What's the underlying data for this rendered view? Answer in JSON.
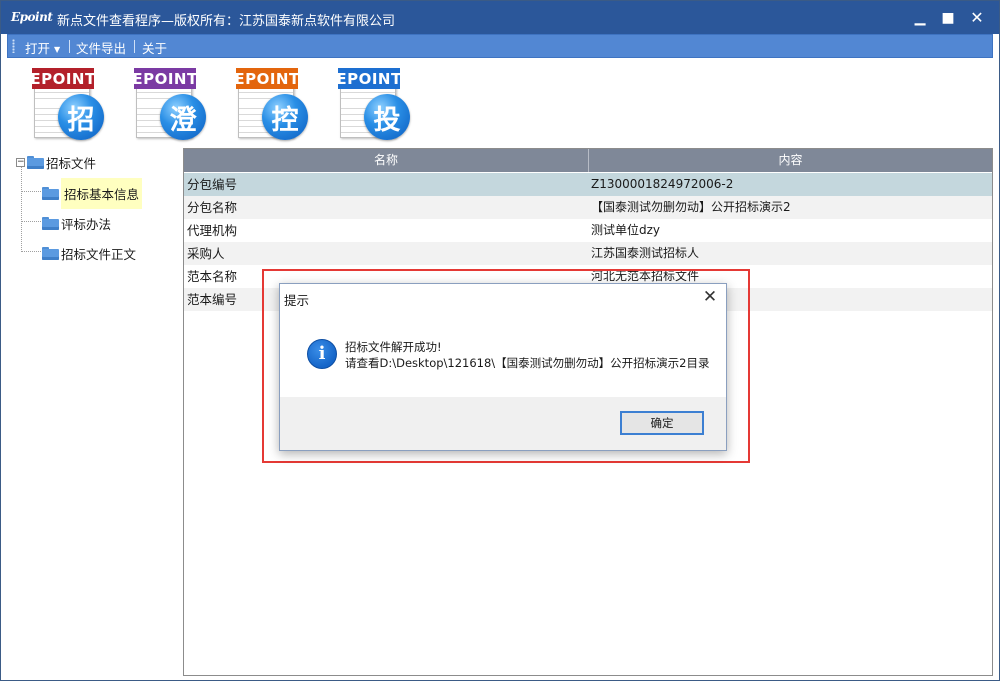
{
  "window": {
    "logo": "Epoint",
    "title": "新点文件查看程序—版权所有：江苏国泰新点软件有限公司",
    "min_glyph": "▁",
    "max_glyph": "■",
    "close_glyph": "✕"
  },
  "menu": {
    "items": [
      {
        "label": "打开",
        "has_dropdown": true
      },
      {
        "label": "文件导出"
      },
      {
        "label": "关于"
      }
    ],
    "dropdown_glyph": "▼"
  },
  "toolbar": {
    "buttons": [
      {
        "brand": "EPOINT",
        "char": "招",
        "color": "#b3202a"
      },
      {
        "brand": "EPOINT",
        "char": "澄",
        "color": "#7b3aa3"
      },
      {
        "brand": "EPOINT",
        "char": "控",
        "color": "#e3650d"
      },
      {
        "brand": "EPOINT",
        "char": "投",
        "color": "#1d6fd1"
      }
    ]
  },
  "tree": {
    "root": {
      "label": "招标文件",
      "expander": "−"
    },
    "children": [
      {
        "label": "招标基本信息",
        "selected": true
      },
      {
        "label": "评标办法"
      },
      {
        "label": "招标文件正文"
      }
    ]
  },
  "grid": {
    "columns": [
      "名称",
      "内容"
    ],
    "rows": [
      [
        "分包编号",
        "Z1300001824972006-2"
      ],
      [
        "分包名称",
        "【国泰测试勿删勿动】公开招标演示2"
      ],
      [
        "代理机构",
        "测试单位dzy"
      ],
      [
        "采购人",
        "江苏国泰测试招标人"
      ],
      [
        "范本名称",
        "河北无范本招标文件"
      ],
      [
        "范本编号",
        ""
      ]
    ]
  },
  "dialog": {
    "title": "提示",
    "close_glyph": "✕",
    "icon_glyph": "i",
    "message_line1": "招标文件解开成功!",
    "message_line2": "请查看D:\\Desktop\\121618\\【国泰测试勿删勿动】公开招标演示2目录",
    "ok_label": "确定"
  },
  "colors": {
    "titlebar": "#2b579a",
    "menubar": "#5287d3",
    "grid_header": "#7f8898",
    "selected_row": "#c4d7dd",
    "highlight": "#e53935"
  }
}
